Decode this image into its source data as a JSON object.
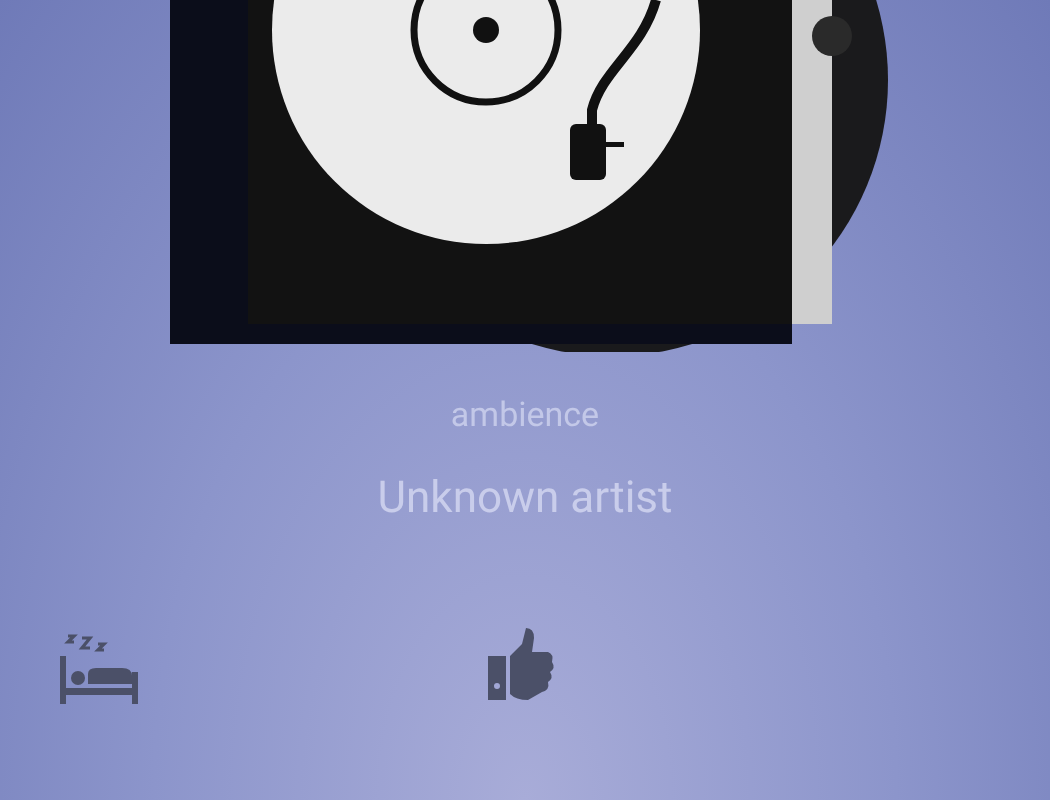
{
  "track": {
    "title": "ambience",
    "artist": "Unknown artist"
  }
}
